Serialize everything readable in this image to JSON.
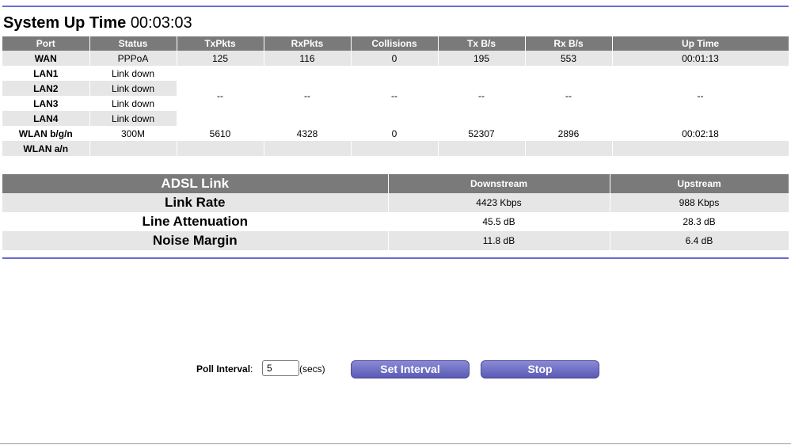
{
  "header": {
    "label": "System Up Time",
    "value": "00:03:03"
  },
  "stats": {
    "columns": [
      "Port",
      "Status",
      "TxPkts",
      "RxPkts",
      "Collisions",
      "Tx B/s",
      "Rx B/s",
      "Up Time"
    ],
    "wan": {
      "port": "WAN",
      "status": "PPPoA",
      "tx": "125",
      "rx": "116",
      "coll": "0",
      "txb": "195",
      "rxb": "553",
      "up": "00:01:13"
    },
    "lan": [
      {
        "port": "LAN1",
        "status": "Link down"
      },
      {
        "port": "LAN2",
        "status": "Link down"
      },
      {
        "port": "LAN3",
        "status": "Link down"
      },
      {
        "port": "LAN4",
        "status": "Link down"
      }
    ],
    "lan_merged": {
      "tx": "--",
      "rx": "--",
      "coll": "--",
      "txb": "--",
      "rxb": "--",
      "up": "--"
    },
    "wlan_bgn": {
      "port": "WLAN b/g/n",
      "status": "300M",
      "tx": "5610",
      "rx": "4328",
      "coll": "0",
      "txb": "52307",
      "rxb": "2896",
      "up": "00:02:18"
    },
    "wlan_an": {
      "port": "WLAN a/n"
    }
  },
  "adsl": {
    "title": "ADSL Link",
    "col_down": "Downstream",
    "col_up": "Upstream",
    "rows": [
      {
        "label": "Link Rate",
        "down": "4423 Kbps",
        "up": "988 Kbps"
      },
      {
        "label": "Line Attenuation",
        "down": "45.5 dB",
        "up": "28.3 dB"
      },
      {
        "label": "Noise Margin",
        "down": "11.8 dB",
        "up": "6.4 dB"
      }
    ]
  },
  "poll": {
    "label": "Poll Interval",
    "colon": ":",
    "value": "5",
    "unit": "(secs)",
    "set_button": "Set Interval",
    "stop_button": "Stop"
  }
}
